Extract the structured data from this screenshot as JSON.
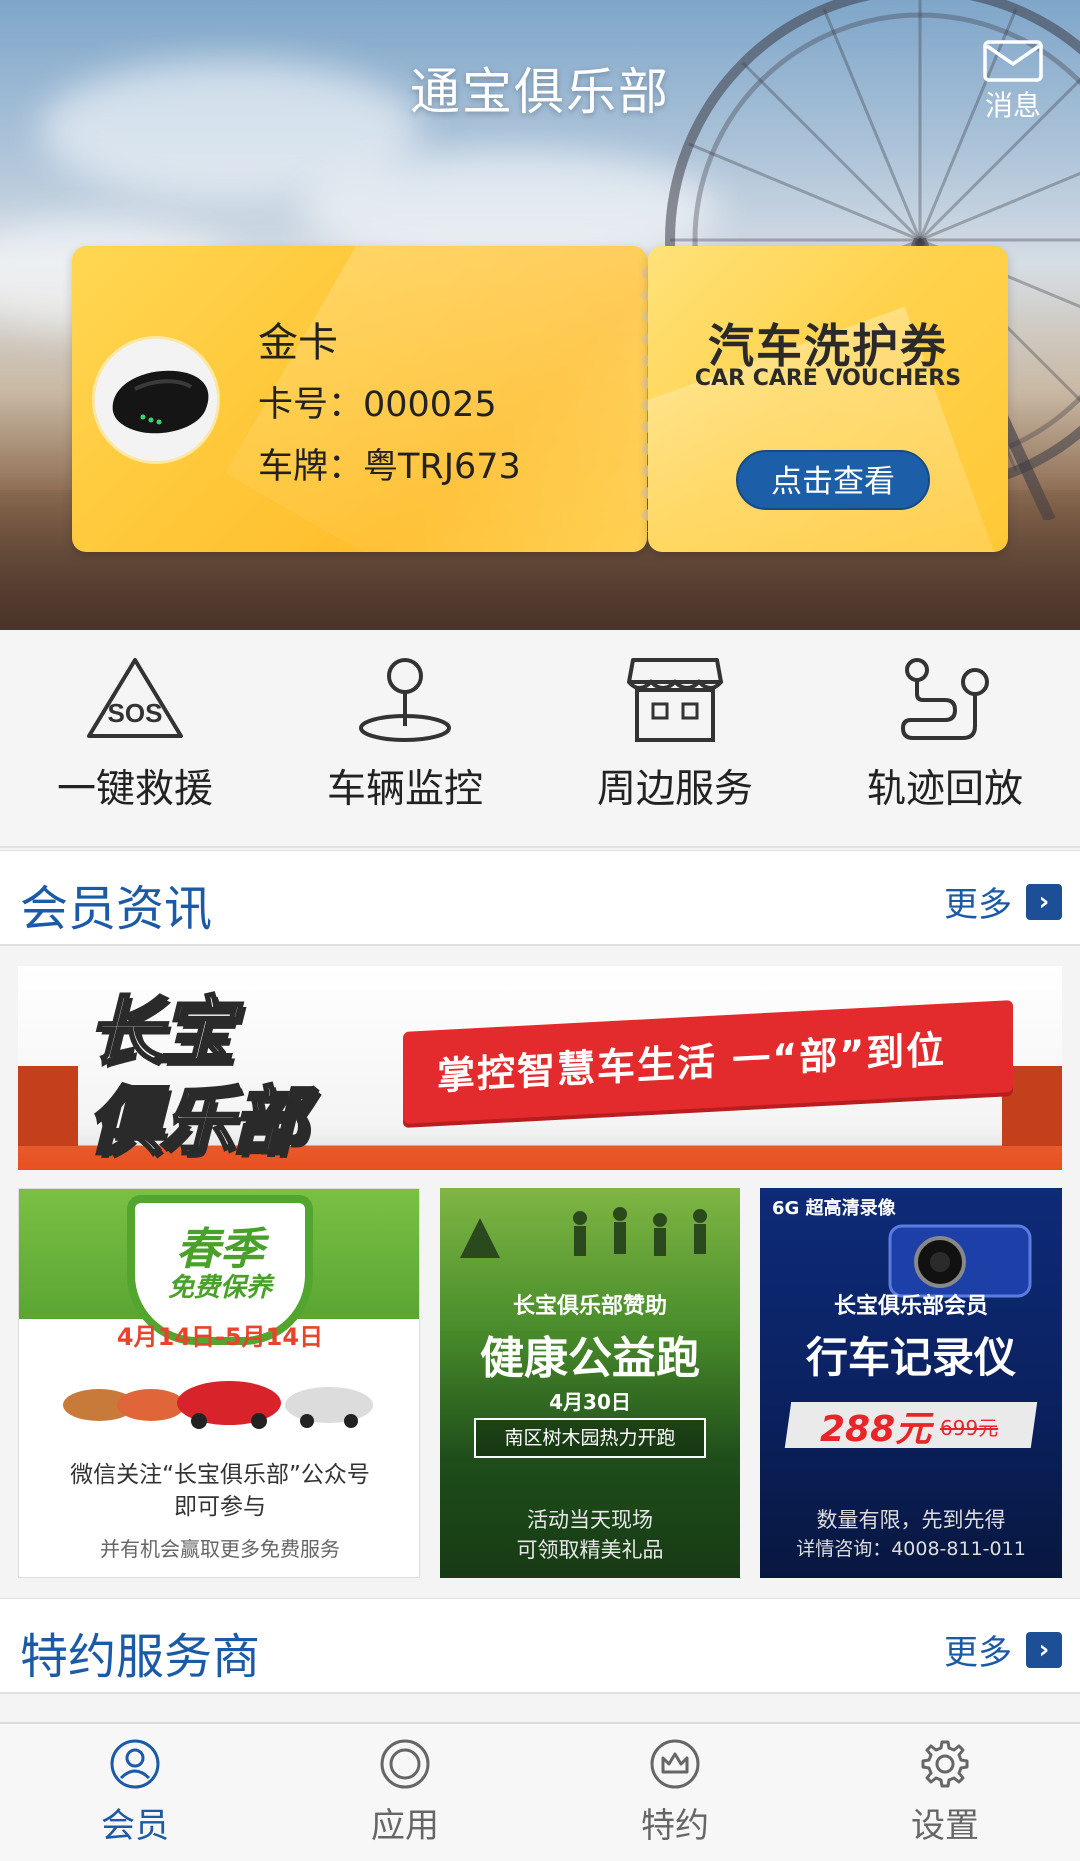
{
  "header": {
    "title": "通宝俱乐部",
    "message_label": "消息"
  },
  "member_card": {
    "level": "金卡",
    "card_no": "卡号：000025",
    "plate": "车牌：粤TRJ673"
  },
  "voucher": {
    "title": "汽车洗护券",
    "subtitle": "CAR CARE VOUCHERS",
    "button": "点击查看"
  },
  "quick_actions": [
    {
      "label": "一键救援",
      "icon": "sos-icon"
    },
    {
      "label": "车辆监控",
      "icon": "location-pin-icon"
    },
    {
      "label": "周边服务",
      "icon": "store-icon"
    },
    {
      "label": "轨迹回放",
      "icon": "route-icon"
    }
  ],
  "news_section": {
    "title": "会员资讯",
    "more": "更多"
  },
  "banner": {
    "line1": "长宝",
    "line2": "俱乐部",
    "slogan": "掌控智慧车生活 一“部”到位"
  },
  "promo1": {
    "title": "春季",
    "subtitle": "免费保养",
    "dates": "4月14日-5月14日",
    "line1": "微信关注“长宝俱乐部”公众号",
    "line2": "即可参与",
    "line3": "并有机会赢取更多免费服务"
  },
  "promo2": {
    "sponsor": "长宝俱乐部赞助",
    "title": "健康公益跑",
    "date": "4月30日",
    "place": "南区树木园热力开跑",
    "gift1": "活动当天现场",
    "gift2": "可领取精美礼品"
  },
  "promo3": {
    "header": "6G 超高清录像",
    "member": "长宝俱乐部会员",
    "title": "行车记录仪",
    "price_new": "288元",
    "price_old": "699元",
    "line1": "数量有限，先到先得",
    "line2": "详情咨询：4008-811-011"
  },
  "partner_section": {
    "title": "特约服务商",
    "more": "更多"
  },
  "tabs": [
    {
      "label": "会员",
      "active": true
    },
    {
      "label": "应用",
      "active": false
    },
    {
      "label": "特约",
      "active": false
    },
    {
      "label": "设置",
      "active": false
    }
  ],
  "colors": {
    "primary": "#1b5aa6",
    "gold": "#ffc83a",
    "voucher_button": "#1c5fa8"
  }
}
